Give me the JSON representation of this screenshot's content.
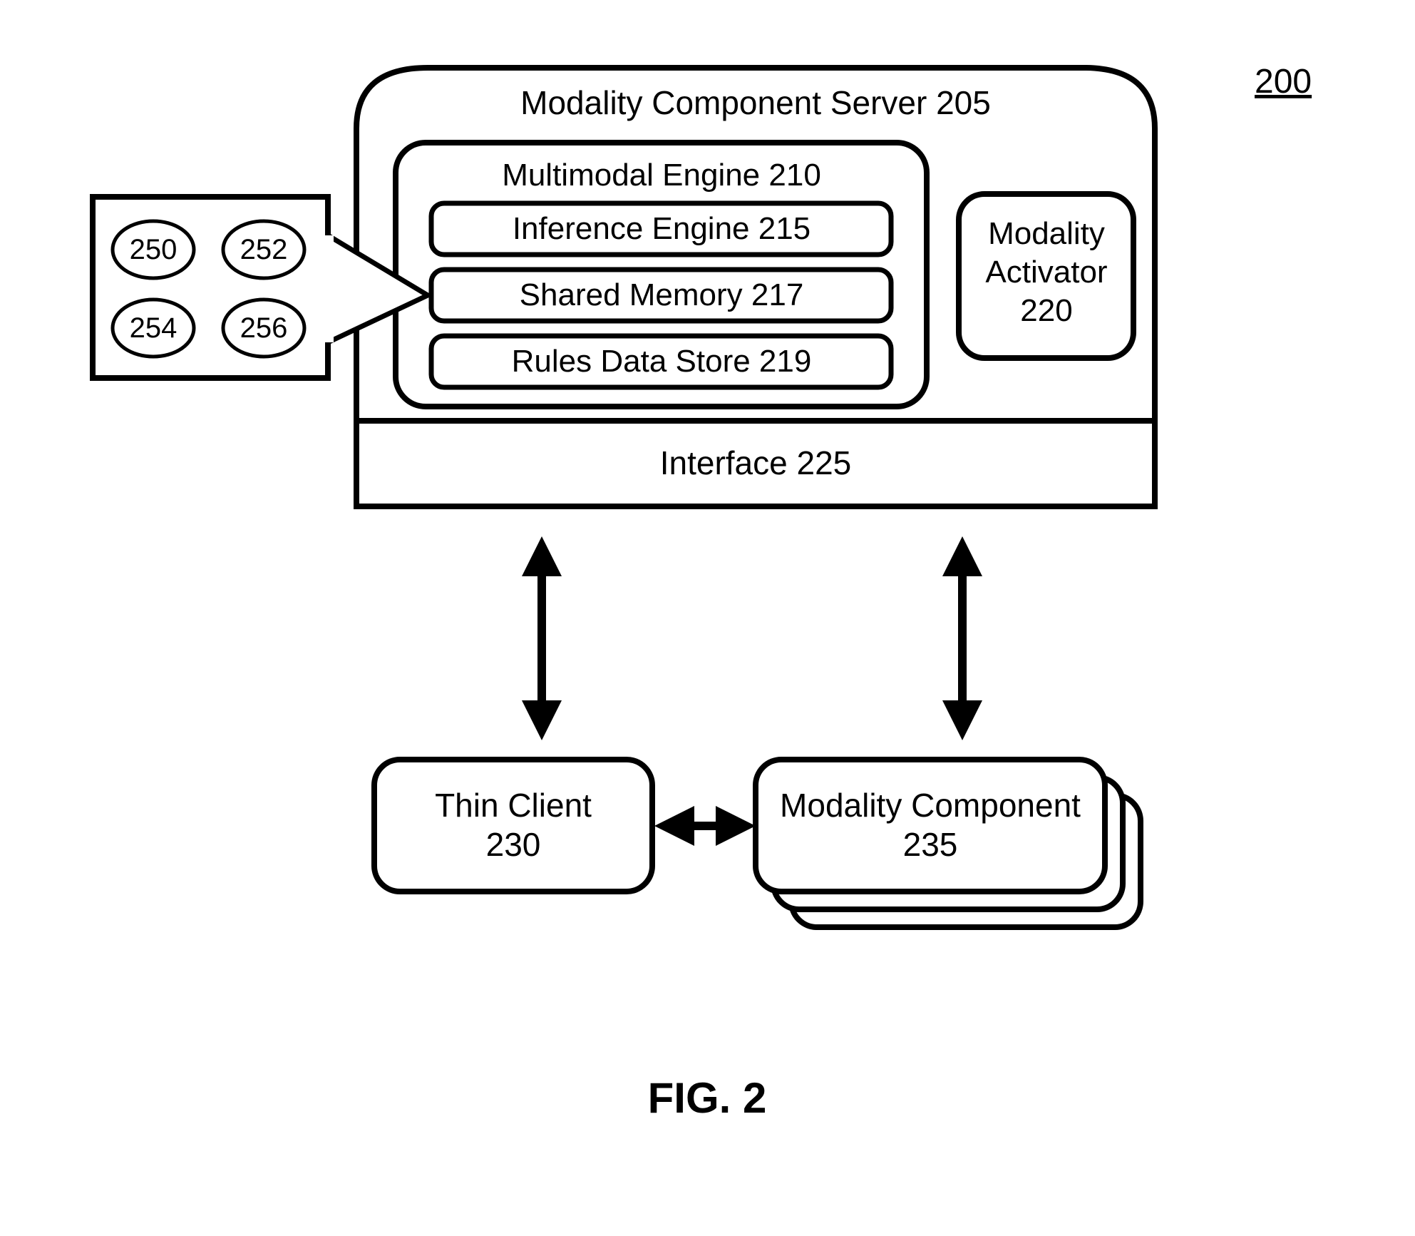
{
  "figure_ref": "200",
  "figure_caption": "FIG. 2",
  "server": {
    "title": "Modality Component Server 205",
    "engine": {
      "title": "Multimodal Engine 210",
      "items": [
        "Inference Engine 215",
        "Shared Memory 217",
        "Rules Data Store 219"
      ]
    },
    "activator": {
      "line1": "Modality",
      "line2": "Activator",
      "line3": "220"
    },
    "interface": "Interface 225"
  },
  "callout": {
    "items": [
      "250",
      "252",
      "254",
      "256"
    ]
  },
  "thin_client": {
    "line1": "Thin Client",
    "line2": "230"
  },
  "modality_component": {
    "line1": "Modality Component",
    "line2": "235"
  }
}
